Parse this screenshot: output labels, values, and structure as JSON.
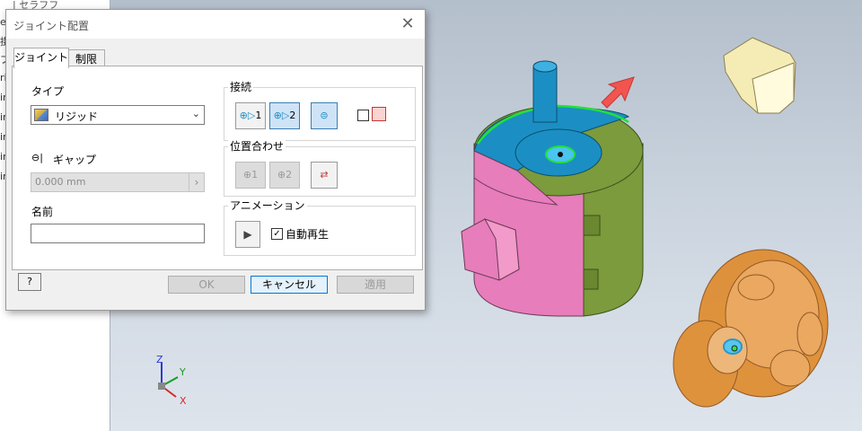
{
  "browser_pane": {
    "rows": [
      "e",
      "掛",
      "プ",
      "ri",
      "in",
      "in",
      "in",
      "in",
      "in"
    ],
    "header_fragment": "| セラフフ"
  },
  "dialog": {
    "title": "ジョイント配置",
    "tabs": [
      {
        "label": "ジョイント",
        "active": true
      },
      {
        "label": "制限",
        "active": false
      }
    ],
    "type_label": "タイプ",
    "type_value": "リジッド",
    "gap_label": "ギャップ",
    "gap_value": "0.000 mm",
    "name_label": "名前",
    "name_value": "",
    "connect_group": {
      "title": "接続",
      "button1": "1",
      "button2": "2"
    },
    "align_group": {
      "title": "位置合わせ",
      "button1": "1",
      "button2": "2"
    },
    "animation_group": {
      "title": "アニメーション",
      "autoplay_label": "自動再生",
      "autoplay_checked": true
    },
    "buttons": {
      "ok": "OK",
      "cancel": "キャンセル",
      "apply": "適用"
    },
    "help_icon": "help-icon"
  },
  "viewcube": {
    "x": "X",
    "y": "Y",
    "z": "Z"
  },
  "colors": {
    "accent": "#0078d7",
    "pink": "#e87cb8",
    "olive": "#7a9a3d",
    "cyan": "#1b8fc4",
    "orange": "#e08a2a",
    "green_edge": "#22e03a"
  }
}
